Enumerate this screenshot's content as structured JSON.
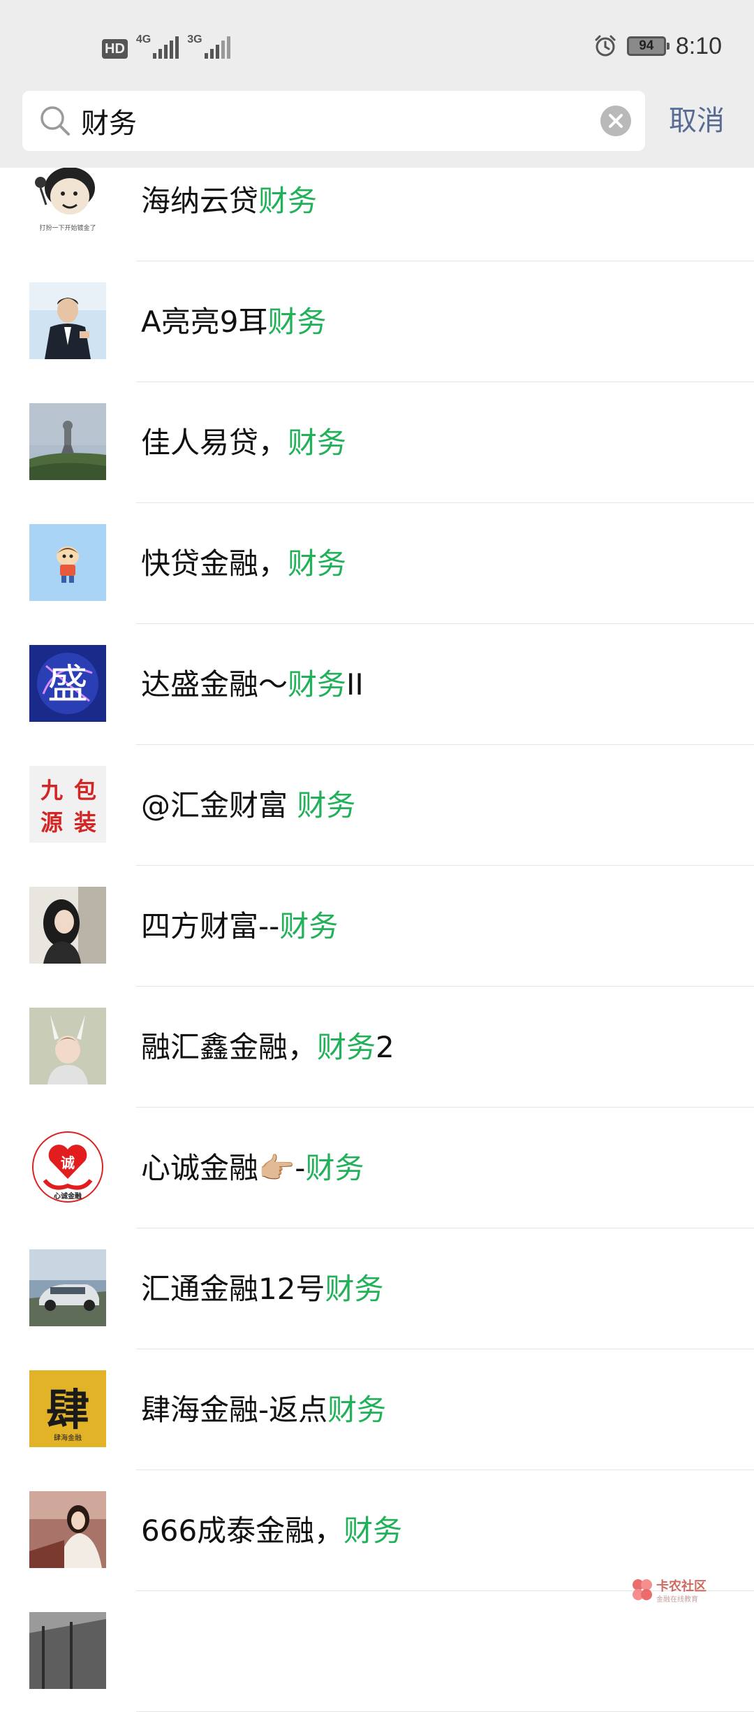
{
  "status_bar": {
    "hd": "HD",
    "sim1_network": "4G",
    "sim2_network": "3G",
    "battery": "94",
    "time": "8:10"
  },
  "search": {
    "query": "财务",
    "cancel_label": "取消"
  },
  "results": [
    {
      "prefix": "海纳云贷",
      "highlight": "财务",
      "suffix": "",
      "avatar_caption": "打扮一下开始镀金了"
    },
    {
      "prefix": "A亮亮9耳",
      "highlight": "财务",
      "suffix": ""
    },
    {
      "prefix": "佳人易贷，",
      "highlight": "财务",
      "suffix": ""
    },
    {
      "prefix": "快贷金融，",
      "highlight": "财务",
      "suffix": ""
    },
    {
      "prefix": "达盛金融～",
      "highlight": "财务",
      "suffix": "II",
      "avatar_glyph": "盛"
    },
    {
      "prefix": "@汇金财富 ",
      "highlight": "财务",
      "suffix": "",
      "avatar_glyphs": [
        "九",
        "包",
        "源",
        "装"
      ]
    },
    {
      "prefix": "四方财富--",
      "highlight": "财务",
      "suffix": ""
    },
    {
      "prefix": "融汇鑫金融，",
      "highlight": "财务",
      "suffix": "2"
    },
    {
      "prefix": "心诚金融👉🏼-",
      "highlight": "财务",
      "suffix": "",
      "avatar_glyph": "诚",
      "avatar_caption": "心诚金融"
    },
    {
      "prefix": "汇通金融12号",
      "highlight": "财务",
      "suffix": ""
    },
    {
      "prefix": "肆海金融-返点",
      "highlight": "财务",
      "suffix": "",
      "avatar_glyph": "肆",
      "avatar_caption": "肆海金融"
    },
    {
      "prefix": "666成泰金融，",
      "highlight": "财务",
      "suffix": ""
    }
  ],
  "watermark": {
    "title": "卡农社区",
    "subtitle": "金融在线教育"
  },
  "colors": {
    "highlight": "#20b159",
    "cancel": "#576b95",
    "header_bg": "#ededed"
  }
}
